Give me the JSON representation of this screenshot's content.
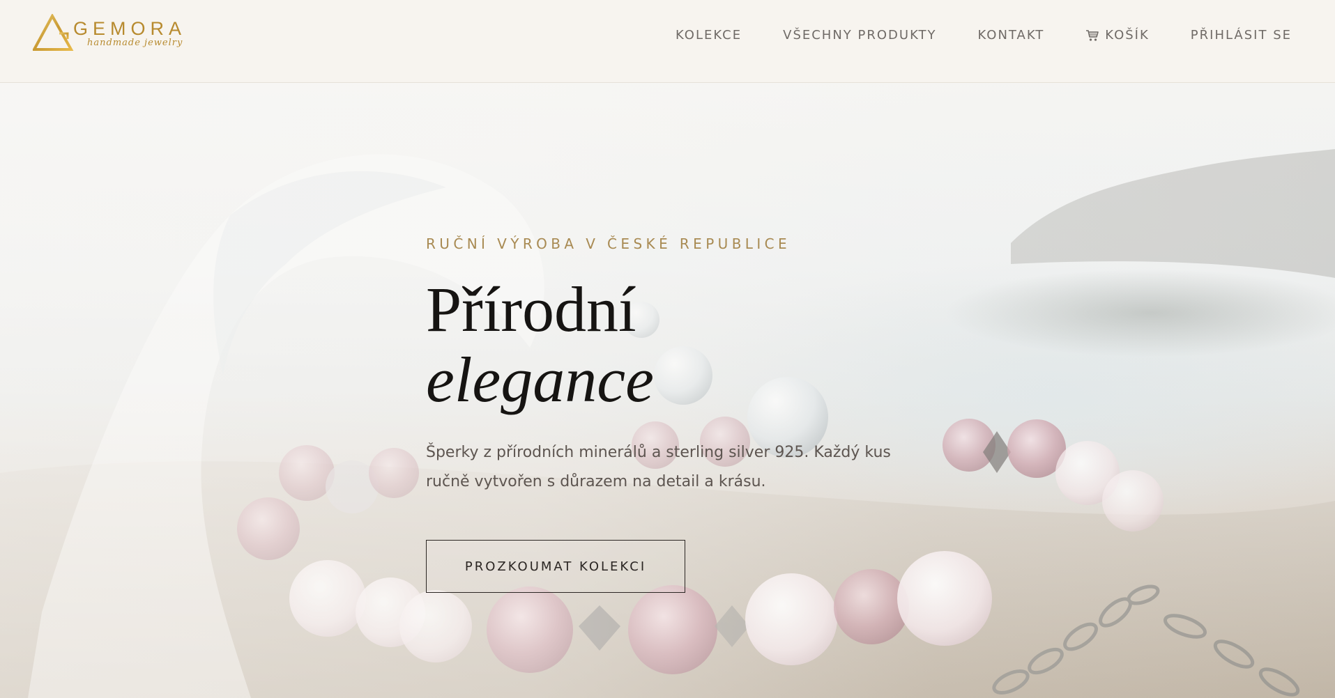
{
  "brand": {
    "name": "GEMORA",
    "tagline": "handmade jewelry",
    "color": "#b78a2e"
  },
  "nav": {
    "items": [
      {
        "label": "KOLEKCE"
      },
      {
        "label": "VŠECHNY PRODUKTY"
      },
      {
        "label": "KONTAKT"
      },
      {
        "label": "KOŠÍK",
        "icon": "cart-icon"
      },
      {
        "label": "PŘIHLÁSIT SE"
      }
    ]
  },
  "hero": {
    "eyebrow": "RUČNÍ VÝROBA V ČESKÉ REPUBLICE",
    "title_line1": "Přírodní",
    "title_line2": "elegance",
    "description": "Šperky z přírodních minerálů a sterling silver 925. Každý kus ručně vytvořen s důrazem na detail a krásu.",
    "cta_label": "PROZKOUMAT KOLEKCI",
    "background_image": "bracelet-with-pink-beads-and-water-splash"
  },
  "colors": {
    "accent": "#a88a52",
    "text_dark": "#161412",
    "nav_text": "#6f6a66",
    "header_bg": "#f7f4ef"
  }
}
